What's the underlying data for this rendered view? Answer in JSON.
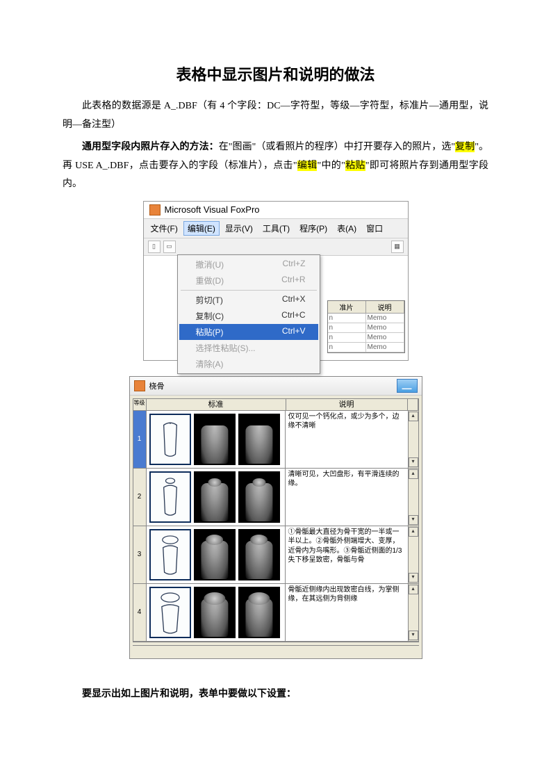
{
  "title": "表格中显示图片和说明的做法",
  "para1_prefix": "此表格的数据源是 A_.DBF（有 4 个字段：DC—字符型，等级—字符型，标准片—通用型，说明—备注型）",
  "para2": {
    "lead_bold": "通用型字段内照片存入的方法：",
    "seg1": "在\"图画\"（或看照片的程序）中打开要存入的照片，选\"",
    "hl1": "复制",
    "seg2": "\"。再 USE  A_.DBF，点击要存入的字段（标准片），点击\"",
    "hl2": "编辑",
    "seg3": "\"中的\"",
    "hl3": "粘贴",
    "seg4": "\"即可将照片存到通用型字段内。"
  },
  "foxpro": {
    "app_title": "Microsoft Visual FoxPro",
    "menus": {
      "file": "文件(F)",
      "edit": "编辑(E)",
      "view": "显示(V)",
      "tools": "工具(T)",
      "program": "程序(P)",
      "table": "表(A)",
      "window": "窗口"
    },
    "edit_items": [
      {
        "label": "撤消(U)",
        "accel": "Ctrl+Z",
        "state": "disabled"
      },
      {
        "label": "重做(D)",
        "accel": "Ctrl+R",
        "state": "disabled"
      },
      {
        "sep": true
      },
      {
        "label": "剪切(T)",
        "accel": "Ctrl+X",
        "state": "normal"
      },
      {
        "label": "复制(C)",
        "accel": "Ctrl+C",
        "state": "normal"
      },
      {
        "label": "粘贴(P)",
        "accel": "Ctrl+V",
        "state": "selected"
      },
      {
        "label": "选择性粘贴(S)...",
        "accel": "",
        "state": "disabled"
      },
      {
        "label": "清除(A)",
        "accel": "",
        "state": "disabled"
      }
    ],
    "mini_table": {
      "head1": "准片",
      "head2": "说明",
      "rows": [
        {
          "c1": "n",
          "c2": "Memo"
        },
        {
          "c1": "n",
          "c2": "Memo"
        },
        {
          "c1": "n",
          "c2": "Memo"
        },
        {
          "c1": "n",
          "c2": "Memo"
        }
      ]
    }
  },
  "grid_window": {
    "title": "桡骨",
    "head_col1": "标准",
    "head_col2": "说明",
    "left_head": "等级",
    "rows": [
      {
        "idx": "1",
        "selected": true,
        "desc": "仅可见一个钙化点，或少为多个，边缘不清晰"
      },
      {
        "idx": "2",
        "selected": false,
        "desc": "清晰可见，大凹盘形，有平滑连续的缘。"
      },
      {
        "idx": "3",
        "selected": false,
        "desc": "①骨骺最大直径为骨干宽的一半或一半以上。②骨骺外侧端增大、变厚，近骨内为鸟嘴形。③骨骺近侧面的1/3失下移呈致密，骨骺与骨"
      },
      {
        "idx": "4",
        "selected": false,
        "desc": "骨骺近侧缘内出现致密白线，为掌侧缘，在其远侧为背侧缘"
      }
    ]
  },
  "footer": "要显示出如上图片和说明，表单中要做以下设置："
}
